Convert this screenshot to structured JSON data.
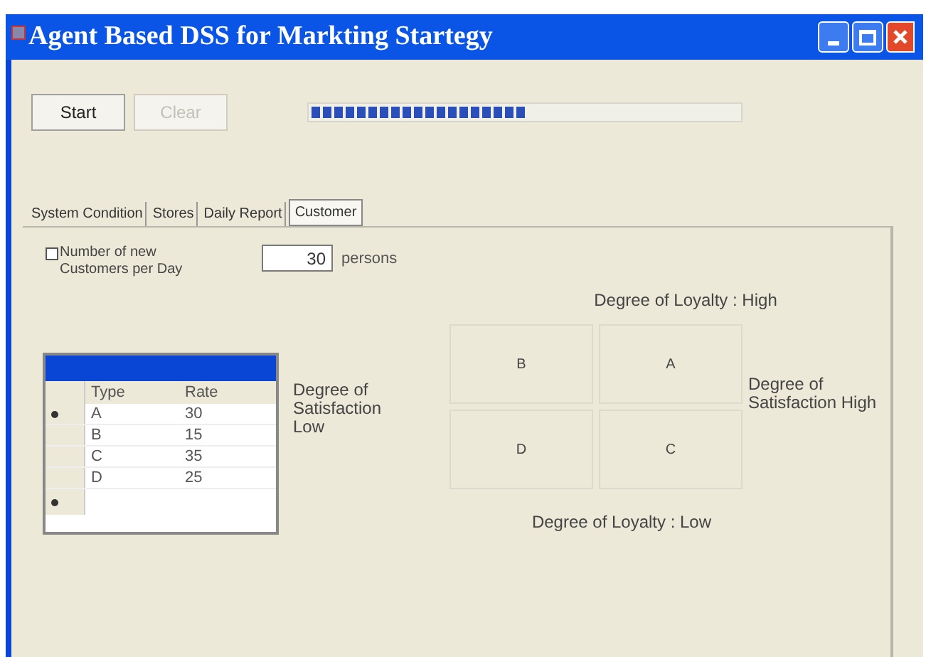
{
  "window": {
    "title": "Agent Based DSS for Markting Startegy"
  },
  "buttons": [
    {
      "label": "Start",
      "disabled": false
    },
    {
      "label": "Clear",
      "disabled": true
    }
  ],
  "progress": {
    "level": 0.5
  },
  "tabs": [
    {
      "label": "System Condition",
      "selected": false
    },
    {
      "label": "Stores",
      "selected": false
    },
    {
      "label": "Daily Report",
      "selected": false
    },
    {
      "label": "Customer",
      "selected": true
    }
  ],
  "new_customers": {
    "label": "Number of new Customers per Day",
    "checked": false,
    "value": "30",
    "unit": "persons"
  },
  "table": {
    "columns": [
      "Type",
      "Rate"
    ],
    "rows": [
      {
        "cells": [
          "A",
          "30"
        ],
        "current": true
      },
      {
        "cells": [
          "B",
          "15"
        ],
        "current": false
      },
      {
        "cells": [
          "C",
          "35"
        ],
        "current": false
      },
      {
        "cells": [
          "D",
          "25"
        ],
        "current": false
      }
    ],
    "new_row": true
  },
  "matrix": {
    "top_label": "Degree of Loyalty : High",
    "left_label": "Degree of Satisfaction Low",
    "right_label": "Degree of Satisfaction High",
    "bottom_label": "Degree of Loyalty : Low",
    "cells": [
      "B",
      "A",
      "D",
      "C"
    ]
  }
}
